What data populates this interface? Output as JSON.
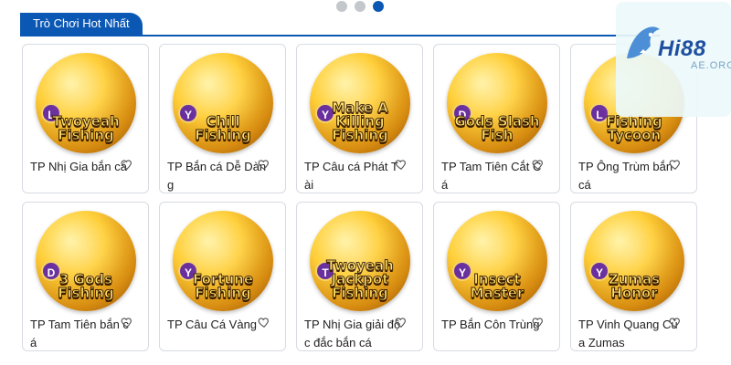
{
  "carousel": {
    "dots": 3,
    "active_index": 2
  },
  "section": {
    "title": "Trò Chơi Hot Nhất"
  },
  "brand": {
    "name": "Hi88",
    "domain_fragment": "AE.ORG"
  },
  "colors": {
    "accent": "#0b58b4"
  },
  "games": [
    {
      "name": "TP Nhị Gia bắn cá",
      "logo": "Twoyeah Fishing",
      "badge": "L",
      "icon": "heart-outline-icon"
    },
    {
      "name": "TP Bắn cá Dễ Dàng",
      "logo": "Chill Fishing",
      "badge": "Y",
      "icon": "heart-outline-icon"
    },
    {
      "name": "TP Câu cá Phát Tài",
      "logo": "Make A Killing Fishing",
      "badge": "Y",
      "icon": "heart-outline-icon"
    },
    {
      "name": "TP Tam Tiên Cắt Cá",
      "logo": "Gods Slash Fish",
      "badge": "D",
      "icon": "heart-outline-icon"
    },
    {
      "name": "TP Ông Trùm bắn cá",
      "logo": "Fishing Tycoon",
      "badge": "L",
      "icon": "heart-outline-icon"
    },
    {
      "name": "TP Tam Tiên bắn cá",
      "logo": "3 Gods Fishing",
      "badge": "D",
      "icon": "heart-outline-icon"
    },
    {
      "name": "TP Câu Cá Vàng",
      "logo": "Fortune Fishing",
      "badge": "Y",
      "icon": "heart-outline-icon"
    },
    {
      "name": "TP Nhị Gia giải độc đắc bắn cá",
      "logo": "Twoyeah Jackpot Fishing",
      "badge": "T",
      "icon": "heart-outline-icon"
    },
    {
      "name": "TP Bắn Côn Trùng",
      "logo": "Insect Master",
      "badge": "Y",
      "icon": "heart-outline-icon"
    },
    {
      "name": "TP Vinh Quang Của Zumas",
      "logo": "Zumas Honor",
      "badge": "Y",
      "icon": "heart-outline-icon"
    }
  ]
}
